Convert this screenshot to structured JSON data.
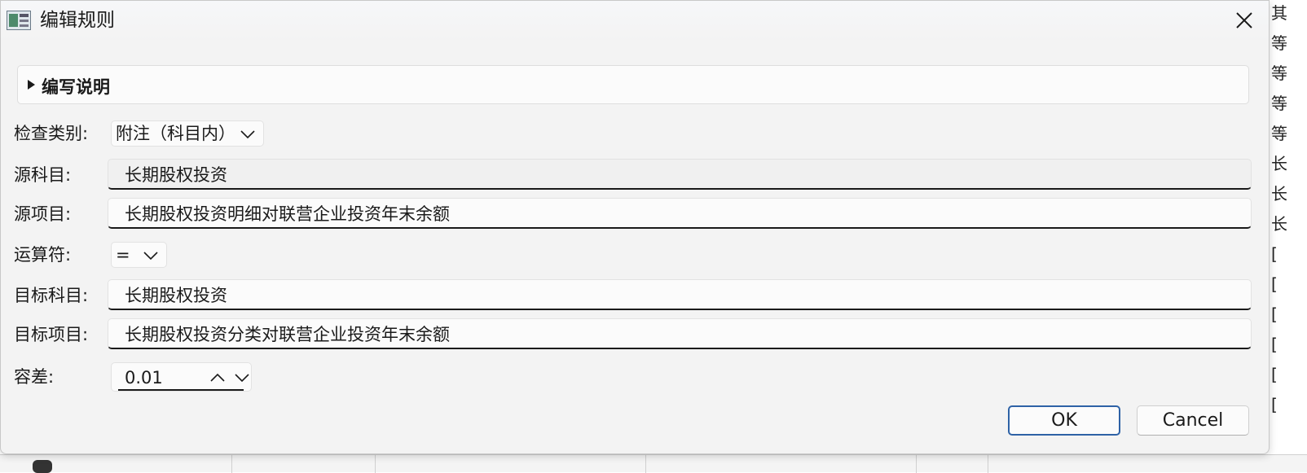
{
  "window": {
    "title": "编辑规则"
  },
  "expander": {
    "label": "编写说明"
  },
  "form": {
    "check_type": {
      "label": "检查类别:",
      "value": "附注（科目内）"
    },
    "source_account": {
      "label": "源科目:",
      "value": "长期股权投资"
    },
    "source_item": {
      "label": "源项目:",
      "value": "长期股权投资明细对联营企业投资年末余额"
    },
    "operator": {
      "label": "运算符:",
      "value": "="
    },
    "target_account": {
      "label": "目标科目:",
      "value": "长期股权投资"
    },
    "target_item": {
      "label": "目标项目:",
      "value": "长期股权投资分类对联营企业投资年末余额"
    },
    "tolerance": {
      "label": "容差:",
      "value": "0.01"
    }
  },
  "buttons": {
    "ok": "OK",
    "cancel": "Cancel"
  },
  "background": {
    "right_chars": [
      "其",
      "等",
      "等",
      "等",
      "等",
      "长",
      "长",
      "长",
      "[",
      "[",
      "[",
      "[",
      "[",
      "["
    ]
  },
  "colors": {
    "dialog_bg": "#f3f3f3",
    "ok_border": "#2e62a6",
    "text": "#1a1a1a"
  }
}
